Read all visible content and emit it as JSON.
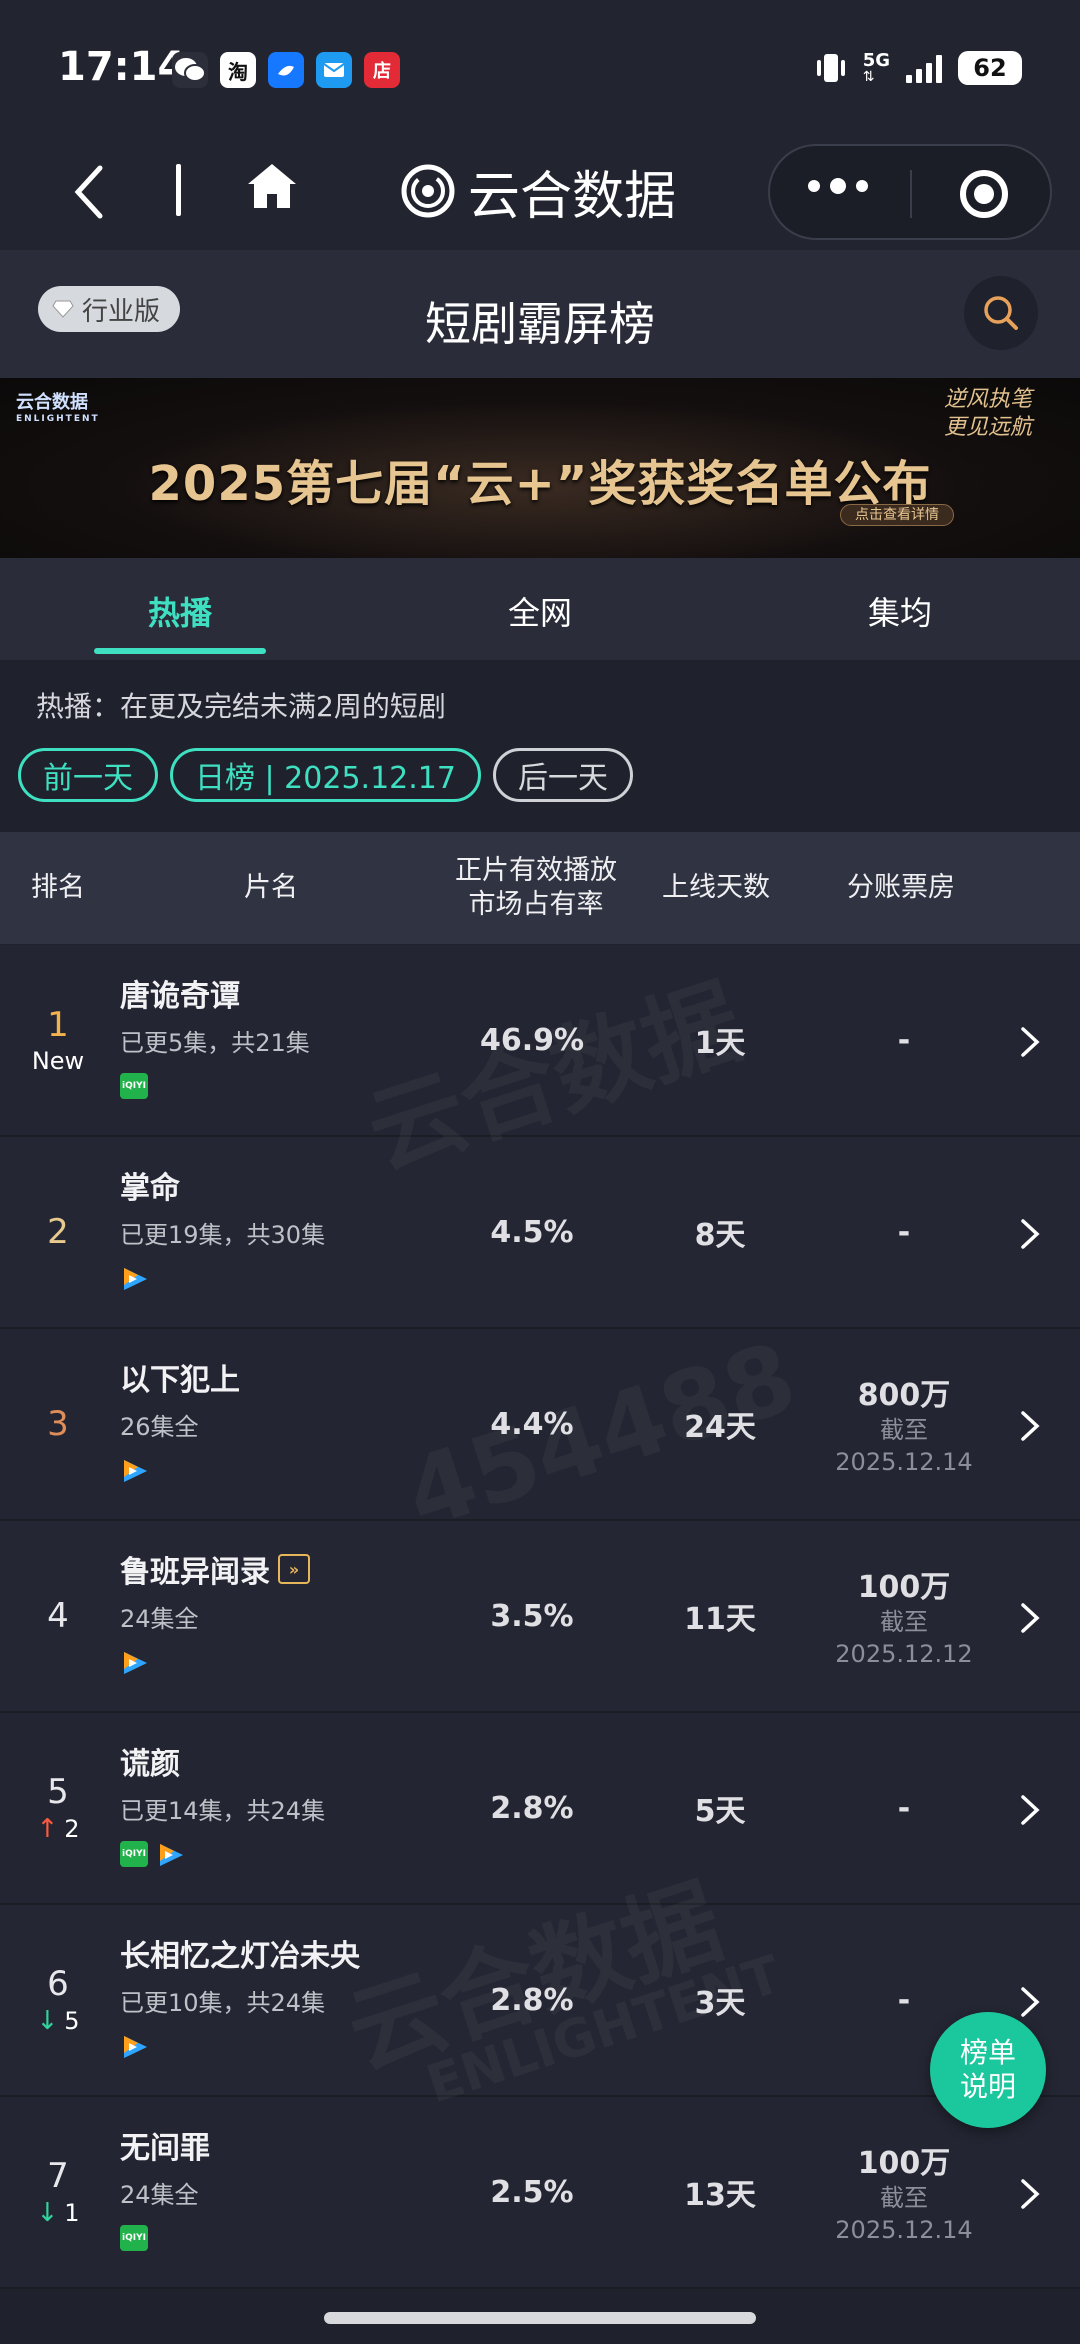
{
  "status_bar": {
    "time": "17:14",
    "network": "5G",
    "battery": "62",
    "app_icons": [
      "wechat-icon",
      "taobao-icon",
      "alipay-icon",
      "mail-icon",
      "shop-icon"
    ],
    "taobao_glyph": "淘",
    "shop_glyph": "店"
  },
  "nav": {
    "title": "云合数据"
  },
  "header": {
    "badge": "行业版",
    "title": "短剧霸屏榜"
  },
  "banner": {
    "logo": "云合数据",
    "logo_en": "ENLIGHTENT",
    "text": "2025第七届“云+”奖获奖名单公布",
    "slogan_line1": "逆风执笔",
    "slogan_line2": "更见远航",
    "cta": "点击查看详情"
  },
  "tabs": [
    {
      "label": "热播",
      "active": true
    },
    {
      "label": "全网",
      "active": false
    },
    {
      "label": "集均",
      "active": false
    }
  ],
  "description": "热播：在更及完结未满2周的短剧",
  "date_nav": {
    "prev": "前一天",
    "current": "日榜 | 2025.12.17",
    "next": "后一天"
  },
  "table": {
    "headers": {
      "rank": "排名",
      "name": "片名",
      "share_line1": "正片有效播放",
      "share_line2": "市场占有率",
      "days": "上线天数",
      "box": "分账票房"
    },
    "rows": [
      {
        "rank": "1",
        "sub": "New",
        "name": "唐诡奇谭",
        "eps": "已更5集，共21集",
        "platforms": [
          "iqiyi"
        ],
        "share": "46.9%",
        "days": "1天",
        "box": "-",
        "box_note1": "",
        "box_note2": ""
      },
      {
        "rank": "2",
        "sub": "",
        "name": "掌命",
        "eps": "已更19集，共30集",
        "platforms": [
          "tencent"
        ],
        "share": "4.5%",
        "days": "8天",
        "box": "-",
        "box_note1": "",
        "box_note2": ""
      },
      {
        "rank": "3",
        "sub": "",
        "name": "以下犯上",
        "eps": "26集全",
        "platforms": [
          "tencent"
        ],
        "share": "4.4%",
        "days": "24天",
        "box": "800万",
        "box_note1": "截至",
        "box_note2": "2025.12.14"
      },
      {
        "rank": "4",
        "sub": "",
        "name": "鲁班异闻录",
        "eps": "24集全",
        "platforms": [
          "tencent"
        ],
        "share": "3.5%",
        "days": "11天",
        "box": "100万",
        "box_note1": "截至",
        "box_note2": "2025.12.12"
      },
      {
        "rank": "5",
        "sub": "2",
        "trend": "up",
        "name": "谎颜",
        "eps": "已更14集，共24集",
        "platforms": [
          "iqiyi",
          "tencent"
        ],
        "share": "2.8%",
        "days": "5天",
        "box": "-",
        "box_note1": "",
        "box_note2": ""
      },
      {
        "rank": "6",
        "sub": "5",
        "trend": "down",
        "name": "长相忆之灯冶未央",
        "eps": "已更10集，共24集",
        "platforms": [
          "tencent"
        ],
        "share": "2.8%",
        "days": "3天",
        "box": "-",
        "box_note1": "",
        "box_note2": ""
      },
      {
        "rank": "7",
        "sub": "1",
        "trend": "down",
        "name": "无间罪",
        "eps": "24集全",
        "platforms": [
          "iqiyi"
        ],
        "share": "2.5%",
        "days": "13天",
        "box": "100万",
        "box_note1": "截至",
        "box_note2": "2025.12.14"
      }
    ]
  },
  "platform_labels": {
    "iqiyi": "iQIYI"
  },
  "float_button": {
    "line1": "榜单",
    "line2": "说明"
  },
  "trend_glyphs": {
    "up": "↑",
    "down": "↓"
  },
  "watermark_texts": {
    "brand": "云合数据",
    "brand_en": "ENLIGHTENT",
    "number": "454488"
  },
  "colors": {
    "accent": "#3ee0c1",
    "rank1": "#f2b34e",
    "rank3": "#e08e59",
    "up": "#ff5a3d",
    "down": "#30d39a",
    "iqiyi": "#22b24c"
  }
}
